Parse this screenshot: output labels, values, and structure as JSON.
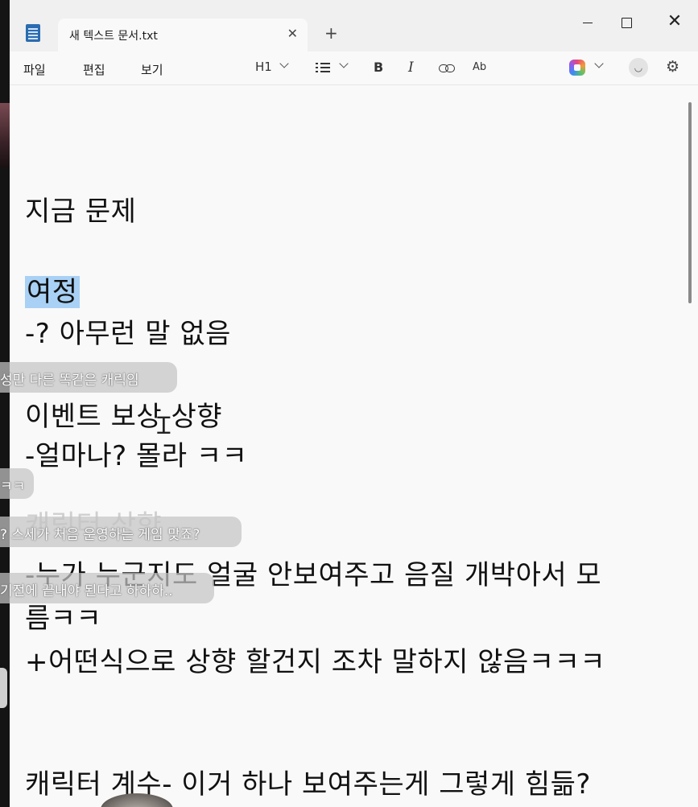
{
  "window": {
    "tab_title": "새 텍스트 문서.txt",
    "tab_close": "✕",
    "new_tab": "+",
    "close": "✕"
  },
  "menu": {
    "file": "파일",
    "edit": "편집",
    "view": "보기"
  },
  "toolbar": {
    "heading": "H1",
    "bold": "B",
    "italic": "I",
    "spell": "Ab",
    "profile": "\u0006"
  },
  "document": {
    "lines": [
      "지금 문제",
      "여정",
      "-? 아무런 말 없음",
      "이벤트 보상 상향",
      "-얼마나? 몰라 ㅋㅋ",
      "캐릭터 상향",
      "-누가 누군지도 얼굴 안보여주고 음질 개박아서 모",
      "름ㅋㅋ",
      "+어떤식으로 상향 할건지 조차 말하지 않음ㅋㅋㅋ",
      "캐릭터 계수- 이거 하나 보여주는게 그렇게 힘듦?"
    ]
  },
  "chat": [
    "성만 다른 똑같은 캐릭임",
    "ㅋㅋ",
    "? 스세가 처음 운영하는 게임 맞죠?",
    "기전에 끝내야 된다고 하하하.."
  ],
  "icons": {
    "app": "notepad-icon",
    "list": "list-icon",
    "link": "link-icon",
    "copilot": "copilot-icon",
    "settings": "gear-icon"
  }
}
